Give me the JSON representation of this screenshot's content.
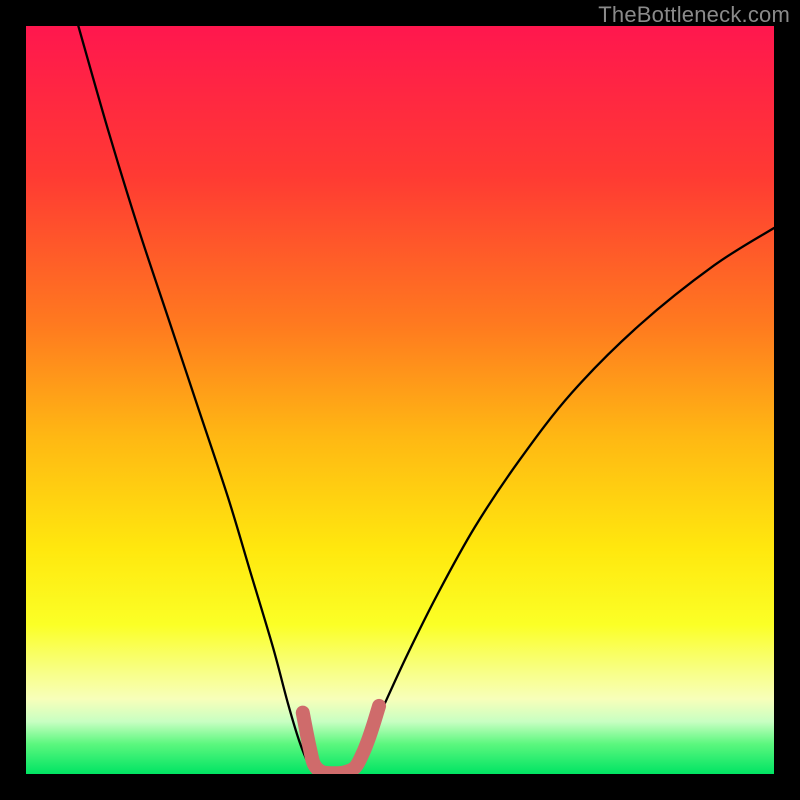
{
  "watermark": "TheBottleneck.com",
  "chart_data": {
    "type": "line",
    "title": "",
    "xlabel": "",
    "ylabel": "",
    "xlim": [
      0,
      100
    ],
    "ylim": [
      0,
      100
    ],
    "grid": false,
    "legend": false,
    "background_gradient_stops": [
      {
        "pos": 0.0,
        "color": "#ff174e"
      },
      {
        "pos": 0.2,
        "color": "#ff3a33"
      },
      {
        "pos": 0.4,
        "color": "#ff7a1f"
      },
      {
        "pos": 0.55,
        "color": "#ffb813"
      },
      {
        "pos": 0.7,
        "color": "#ffe80e"
      },
      {
        "pos": 0.8,
        "color": "#fbff26"
      },
      {
        "pos": 0.86,
        "color": "#f8ff82"
      },
      {
        "pos": 0.9,
        "color": "#f7ffba"
      },
      {
        "pos": 0.93,
        "color": "#c8ffc2"
      },
      {
        "pos": 0.96,
        "color": "#5bf77e"
      },
      {
        "pos": 1.0,
        "color": "#00e463"
      }
    ],
    "series": [
      {
        "name": "curve",
        "color": "#000000",
        "stroke_width": 2.3,
        "x": [
          7,
          11,
          15,
          19,
          23,
          27,
          30,
          33,
          35,
          36.5,
          37.8,
          38.8,
          40.5,
          42.5,
          44.3,
          46,
          48,
          51,
          55,
          60,
          66,
          73,
          82,
          92,
          100
        ],
        "y": [
          100,
          86,
          73,
          61,
          49,
          37,
          27,
          17,
          9.5,
          4.5,
          1.3,
          0,
          0,
          0.6,
          2.2,
          5.0,
          9.5,
          16,
          24,
          33,
          42,
          51,
          60,
          68,
          73
        ]
      },
      {
        "name": "marker_stroke",
        "color": "#cf6b6b",
        "stroke_width": 14,
        "x": [
          37.0,
          37.5,
          38.0,
          38.5,
          39.5,
          41.0,
          42.5,
          44.0,
          45.0,
          45.8,
          46.5,
          47.2
        ],
        "y": [
          8.2,
          5.6,
          3.2,
          1.3,
          0.3,
          0.1,
          0.2,
          0.9,
          2.7,
          4.7,
          6.8,
          9.1
        ]
      }
    ]
  }
}
